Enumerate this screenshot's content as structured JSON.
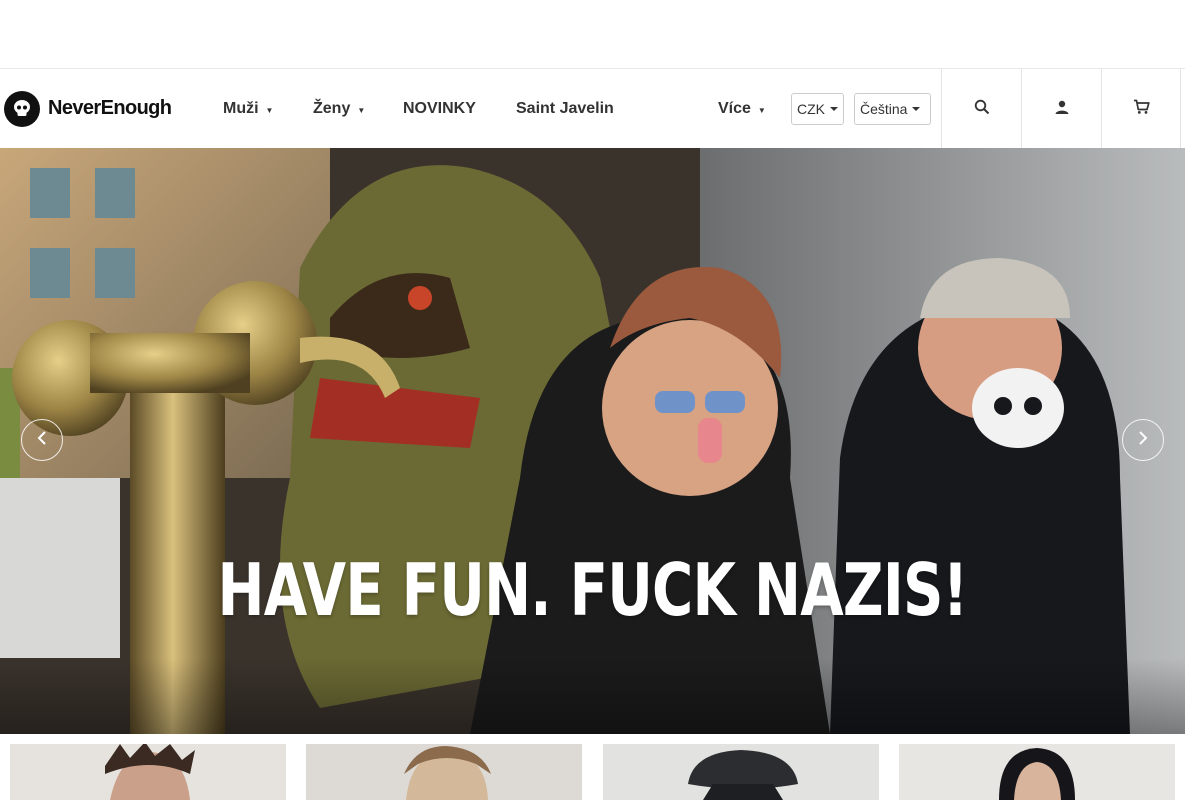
{
  "header": {
    "logo": {
      "text": "NeverEnough"
    },
    "nav": [
      {
        "label": "Muži",
        "has_dropdown": true
      },
      {
        "label": "Ženy",
        "has_dropdown": true
      },
      {
        "label": "NOVINKY",
        "has_dropdown": false
      },
      {
        "label": "Saint Javelin",
        "has_dropdown": false
      }
    ],
    "more": {
      "label": "Více"
    },
    "currency": {
      "selected": "CZK"
    },
    "language": {
      "selected": "Čeština"
    },
    "icons": [
      "search-icon",
      "user-icon",
      "cart-icon"
    ]
  },
  "hero": {
    "headline": "HAVE FUN. FUCK NAZIS!",
    "prev_icon": "chevron-left-icon",
    "next_icon": "chevron-right-icon"
  },
  "category_tiles": [
    {
      "name": "tile-1",
      "background": "#e6e3df"
    },
    {
      "name": "tile-2",
      "background": "#ddd9d4"
    },
    {
      "name": "tile-3",
      "background": "#e2e2e0"
    },
    {
      "name": "tile-4",
      "background": "#e8e6e3"
    }
  ],
  "colors": {
    "text": "#333333",
    "border": "#e4e4e4",
    "hero_text": "#ffffff"
  }
}
